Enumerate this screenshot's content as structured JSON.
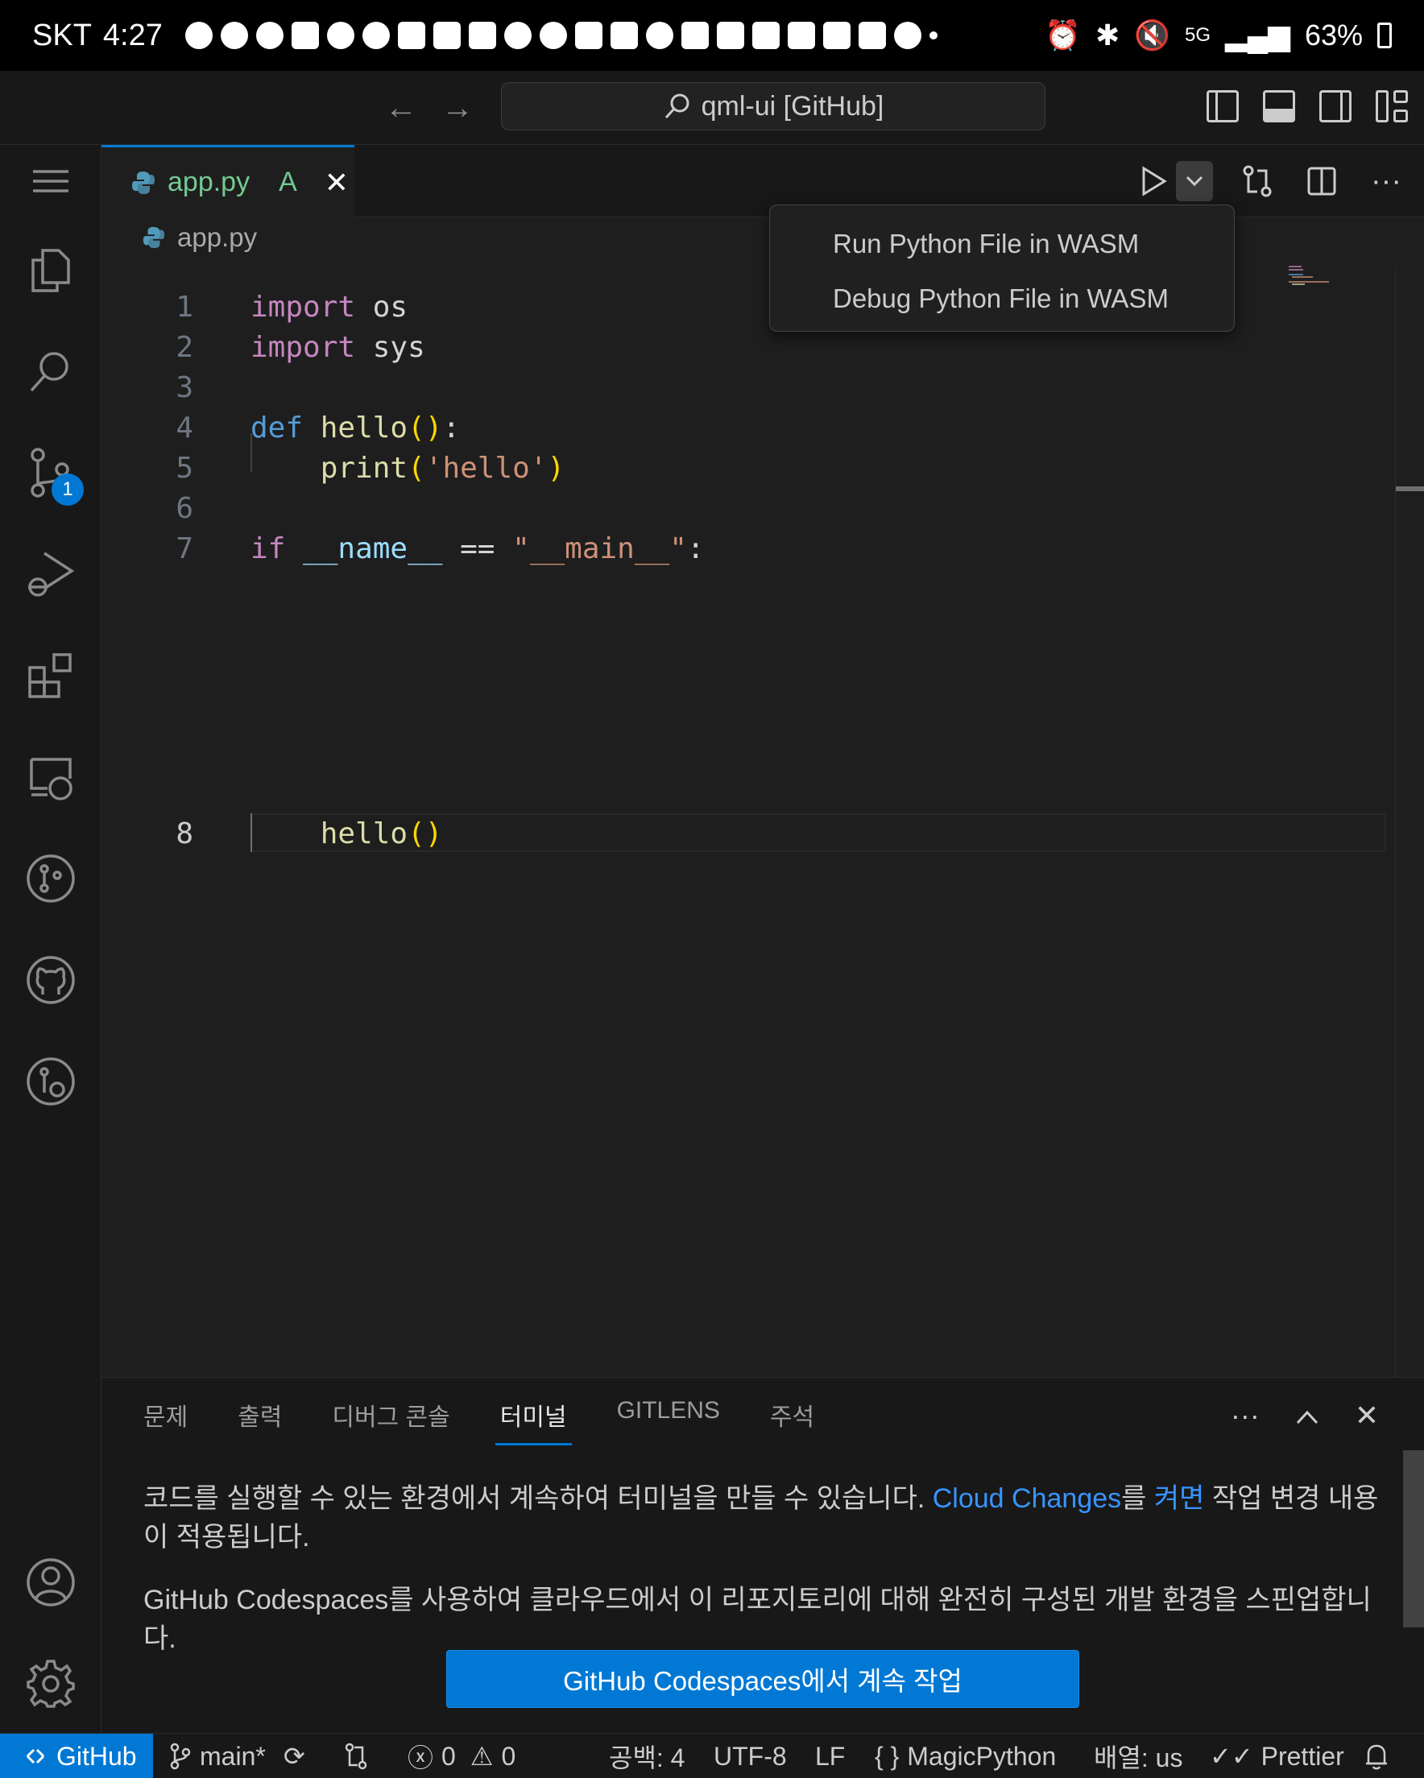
{
  "phone_status": {
    "carrier": "SKT",
    "time": "4:27",
    "network": "5G",
    "battery": "63%"
  },
  "titlebar": {
    "command_center": "qml-ui [GitHub]"
  },
  "activity_badge": "1",
  "tab": {
    "name": "app.py",
    "status": "A"
  },
  "breadcrumb": "app.py",
  "editor": {
    "line_numbers": [
      "1",
      "2",
      "3",
      "4",
      "5",
      "6",
      "7",
      "8"
    ]
  },
  "dropdown": {
    "items": [
      "Run Python File in WASM",
      "Debug Python File in WASM"
    ]
  },
  "panel": {
    "tabs": [
      "문제",
      "출력",
      "디버그 콘솔",
      "터미널",
      "GITLENS",
      "주석"
    ],
    "active_tab": "터미널",
    "msg1_pre": "코드를 실행할 수 있는 환경에서 계속하여 터미널을 만들 수 있습니다. ",
    "msg1_link1": "Cloud Changes",
    "msg1_mid": "를 ",
    "msg1_link2": "켜면",
    "msg1_post": " 작업 변경 내용이 적용됩니다.",
    "msg2": "GitHub Codespaces를 사용하여 클라우드에서 이 리포지토리에 대해 완전히 구성된 개발 환경을 스핀업합니다.",
    "button": "GitHub Codespaces에서 계속 작업"
  },
  "statusbar": {
    "remote": "GitHub",
    "branch": "main*",
    "errors": "0",
    "warnings": "0",
    "indent": "공백: 4",
    "encoding": "UTF-8",
    "eol": "LF",
    "language": "MagicPython",
    "layout": "배열: us",
    "formatter": "Prettier"
  },
  "colors": {
    "accent": "#0078d4",
    "added": "#73c991",
    "keyword": "#c586c0",
    "keyword_blue": "#569cd6",
    "function": "#dcdcaa",
    "string": "#ce9178"
  }
}
